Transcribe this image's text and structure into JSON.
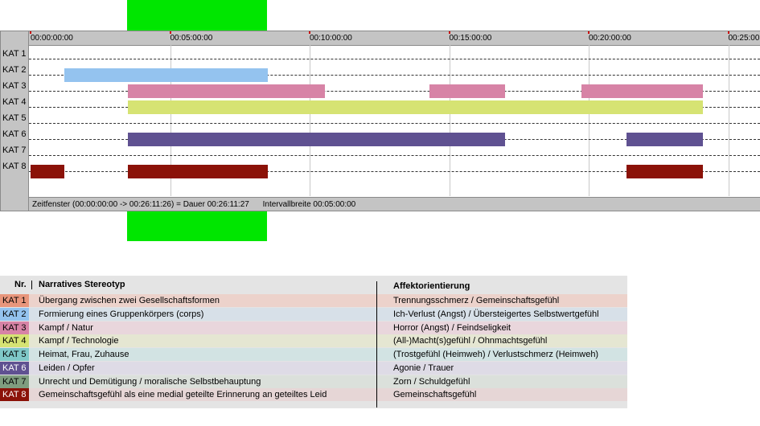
{
  "colors": {
    "selection": "#00e600",
    "kat1": "#e8967c",
    "kat2": "#94c3ef",
    "kat3": "#d783a6",
    "kat4": "#d6e373",
    "kat5": "#7fc8c8",
    "kat6": "#5f5191",
    "kat7": "#7f9d7f",
    "kat8": "#8b1208"
  },
  "timeline": {
    "ticks": [
      "00:00:00:00",
      "00:05:00:00",
      "00:10:00:00",
      "00:15:00:00",
      "00:20:00:00",
      "00:25:00"
    ],
    "tick_minutes": [
      0,
      5,
      10,
      15,
      20,
      25
    ],
    "selection_minutes": [
      3.5,
      8.5
    ],
    "rows": [
      {
        "label": "KAT 1",
        "color": "kat1",
        "segments": []
      },
      {
        "label": "KAT 2",
        "color": "kat2",
        "segments": [
          [
            1.2,
            8.5
          ]
        ]
      },
      {
        "label": "KAT 3",
        "color": "kat3",
        "segments": [
          [
            3.5,
            10.55
          ],
          [
            14.3,
            17.0
          ],
          [
            19.75,
            24.1
          ]
        ]
      },
      {
        "label": "KAT 4",
        "color": "kat4",
        "segments": [
          [
            3.5,
            24.1
          ]
        ]
      },
      {
        "label": "KAT 5",
        "color": "kat5",
        "segments": []
      },
      {
        "label": "KAT 6",
        "color": "kat6",
        "segments": [
          [
            3.5,
            17.0
          ],
          [
            21.35,
            24.1
          ]
        ]
      },
      {
        "label": "KAT 7",
        "color": "kat7",
        "segments": []
      },
      {
        "label": "KAT 8",
        "color": "kat8",
        "segments": [
          [
            0.0,
            1.2
          ],
          [
            3.5,
            8.5
          ],
          [
            21.35,
            24.1
          ]
        ]
      }
    ],
    "status_window": "Zeitfenster (00:00:00:00 -> 00:26:11:26) = Dauer 00:26:11:27",
    "status_interval": "Intervallbreite 00:05:00:00"
  },
  "legend": {
    "col_nr": "Nr.",
    "col_narrative": "Narratives Stereotyp",
    "col_affect": "Affektorientierung",
    "rows": [
      {
        "nr": "KAT 1",
        "narrative": "Übergang zwischen zwei Gesellschaftsformen",
        "affect": "Trennungsschmerz / Gemeinschaftsgefühl",
        "bg": "#ecd2cb"
      },
      {
        "nr": "KAT 2",
        "narrative": "Formierung eines Gruppenkörpers (corps)",
        "affect": "Ich-Verlust (Angst) / Übersteigertes Selbstwertgefühl",
        "bg": "#d7e0e8"
      },
      {
        "nr": "KAT 3",
        "narrative": "Kampf / Natur",
        "affect": "Horror (Angst) / Feindseligkeit",
        "bg": "#e9d6dc"
      },
      {
        "nr": "KAT 4",
        "narrative": "Kampf / Technologie",
        "affect": "(All-)Macht(s)gefühl / Ohnmachtsgefühl",
        "bg": "#e5e6d2"
      },
      {
        "nr": "KAT 5",
        "narrative": "Heimat, Frau, Zuhause",
        "affect": "(Trostgefühl (Heimweh) / Verlustschmerz (Heimweh)",
        "bg": "#d2e3e3"
      },
      {
        "nr": "KAT 6",
        "narrative": "Leiden / Opfer",
        "affect": "Agonie / Trauer",
        "bg": "#dedbe6"
      },
      {
        "nr": "KAT 7",
        "narrative": "Unrecht und Demütigung / moralische Selbstbehauptung",
        "affect": "Zorn / Schuldgefühl",
        "bg": "#dbe0db"
      },
      {
        "nr": "KAT 8",
        "narrative": "Gemeinschaftsgefühl als eine medial geteilte Erinnerung an geteiltes Leid",
        "affect": "Gemeinschaftsgefühl",
        "bg": "#e6d6d6"
      }
    ]
  }
}
